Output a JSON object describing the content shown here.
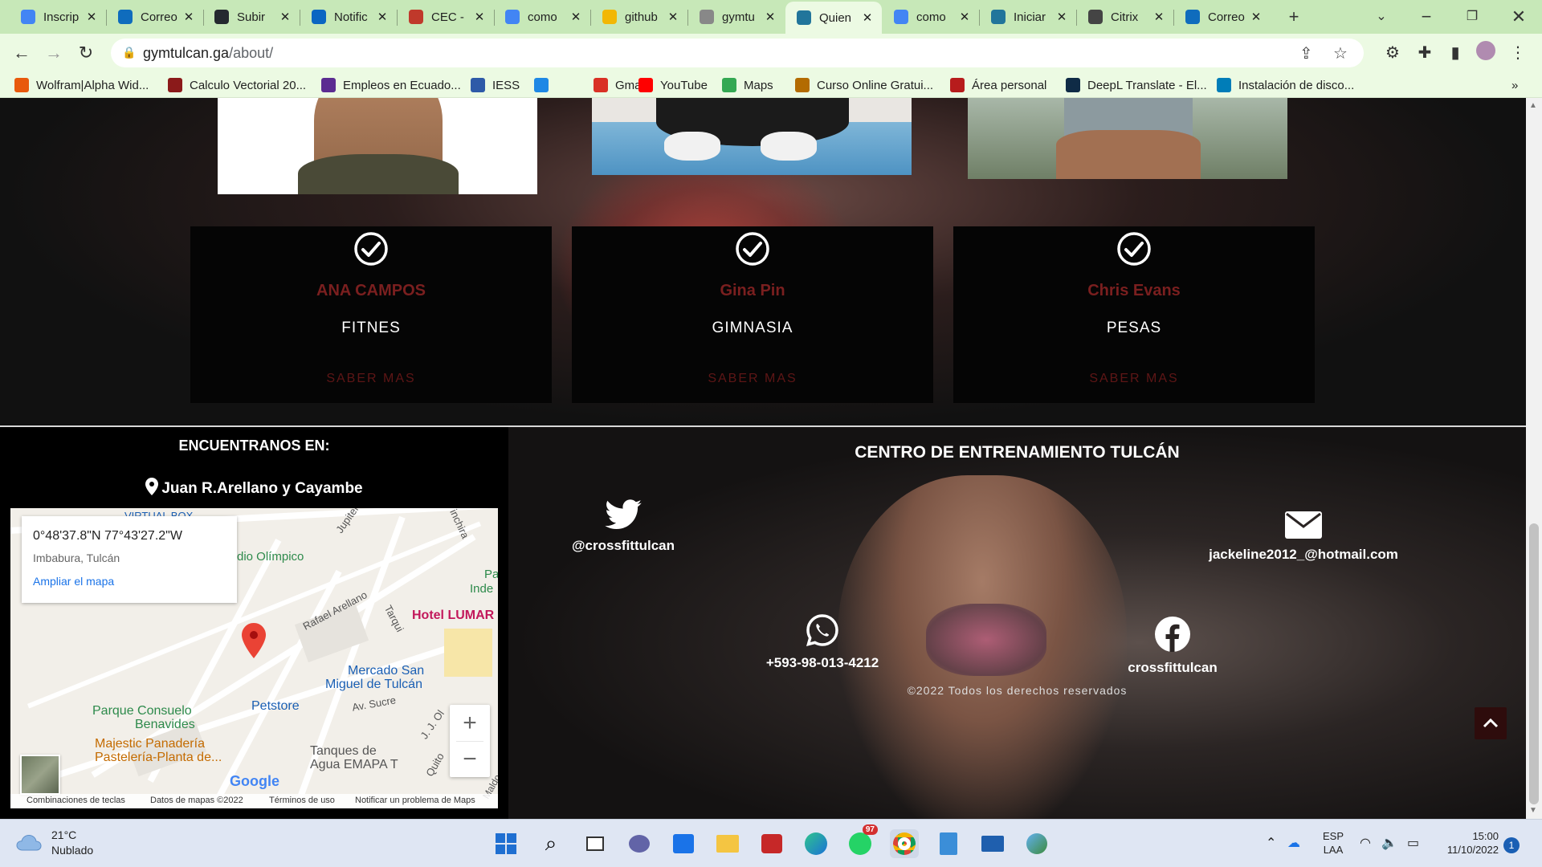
{
  "browser": {
    "tabs": [
      {
        "title": "Inscrip",
        "icon": "google-icon",
        "color": "#4285f4"
      },
      {
        "title": "Correo",
        "icon": "outlook-icon",
        "color": "#0f6cbd"
      },
      {
        "title": "Subir",
        "icon": "github-icon",
        "color": "#24292f"
      },
      {
        "title": "Notific",
        "icon": "linkedin-icon",
        "color": "#0a66c2"
      },
      {
        "title": "CEC -",
        "icon": "cec-icon",
        "color": "#c0392b"
      },
      {
        "title": "como",
        "icon": "google-icon",
        "color": "#4285f4"
      },
      {
        "title": "github",
        "icon": "bookmark-icon",
        "color": "#f2b705"
      },
      {
        "title": "gymtu",
        "icon": "globe-icon",
        "color": "#888888"
      },
      {
        "title": "Quien",
        "icon": "wordpress-icon",
        "color": "#21759b",
        "active": true
      },
      {
        "title": "como",
        "icon": "google-icon",
        "color": "#4285f4"
      },
      {
        "title": "Iniciar",
        "icon": "wordpress-icon",
        "color": "#21759b"
      },
      {
        "title": "Citrix",
        "icon": "citrix-icon",
        "color": "#444444"
      },
      {
        "title": "Correo",
        "icon": "outlook-icon",
        "color": "#0f6cbd"
      }
    ],
    "url_host": "gymtulcan.ga",
    "url_path": "/about/",
    "bookmarks": [
      {
        "label": "Wolfram|Alpha Wid...",
        "icon": "wolfram-icon",
        "color": "#e8590c"
      },
      {
        "label": "Calculo Vectorial 20...",
        "icon": "calc-icon",
        "color": "#8b1a1a"
      },
      {
        "label": "Empleos en Ecuado...",
        "icon": "chevron-icon",
        "color": "#5b2c91"
      },
      {
        "label": "IESS",
        "icon": "iess-icon",
        "color": "#2e5aa8"
      },
      {
        "label": "",
        "icon": "app-store-icon",
        "color": "#1e88e5"
      },
      {
        "label": "Gmail",
        "icon": "gmail-icon",
        "color": "#d93025"
      },
      {
        "label": "YouTube",
        "icon": "youtube-icon",
        "color": "#ff0000"
      },
      {
        "label": "Maps",
        "icon": "maps-icon",
        "color": "#34a853"
      },
      {
        "label": "Curso Online Gratui...",
        "icon": "course-icon",
        "color": "#b36b00"
      },
      {
        "label": "Área personal",
        "icon": "personal-icon",
        "color": "#b71c1c"
      },
      {
        "label": "DeepL Translate - El...",
        "icon": "deepl-icon",
        "color": "#0f2b46"
      },
      {
        "label": "Instalación de disco...",
        "icon": "dell-icon",
        "color": "#007db8"
      }
    ]
  },
  "trainers": [
    {
      "name": "ANA CAMPOS",
      "discipline": "FITNES",
      "button": "SABER MAS"
    },
    {
      "name": "Gina Pin",
      "discipline": "GIMNASIA",
      "button": "SABER MAS"
    },
    {
      "name": "Chris Evans",
      "discipline": "PESAS",
      "button": "SABER MAS"
    }
  ],
  "footer": {
    "find_us_title": "ENCUENTRANOS EN:",
    "address": "Juan R.Arellano y Cayambe",
    "map": {
      "coords": "0°48'37.8\"N 77°43'27.2\"W",
      "place": "Imbabura, Tulcán",
      "enlarge": "Ampliar el mapa",
      "labels": {
        "virtual_box": "VIRTUAL BOX",
        "estadio": "dio Olímpico",
        "jupiter": "Jupiter",
        "inchira": "inchira",
        "pa": "Pa",
        "inde": "Inde",
        "rafael": "Rafael Arellano",
        "tarqui": "Tarqui",
        "hotel": "Hotel LUMAR",
        "mercado1": "Mercado San",
        "mercado2": "Miguel de Tulcán",
        "petstore": "Petstore",
        "sucre": "Av. Sucre",
        "parque1": "Parque Consuelo",
        "parque2": "Benavides",
        "jjolm": "J. J. Ol",
        "panaderia1": "Majestic Panadería",
        "panaderia2": "Pastelería-Planta de...",
        "tanques1": "Tanques de",
        "tanques2": "Agua EMAPA T",
        "quito": "Quito",
        "maldo": "Maldo"
      },
      "google": "Google",
      "footer_links": [
        "Combinaciones de teclas",
        "Datos de mapas ©2022",
        "Términos de uso",
        "Notificar un problema de Maps"
      ]
    },
    "center_title": "CENTRO DE ENTRENAMIENTO TULCÁN",
    "twitter": "@crossfittulcan",
    "email": "jackeline2012_@hotmail.com",
    "whatsapp": "+593-98-013-4212",
    "facebook": "crossfittulcan",
    "copyright": "©2022 Todos los derechos reservados"
  },
  "taskbar": {
    "temperature": "21°C",
    "weather": "Nublado",
    "whatsapp_badge": "97",
    "lang1": "ESP",
    "lang2": "LAA",
    "time": "15:00",
    "date": "11/10/2022",
    "notifications": "1"
  }
}
